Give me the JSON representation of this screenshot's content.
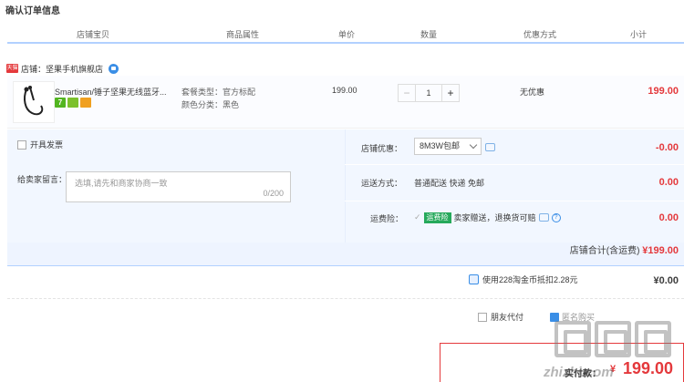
{
  "page": {
    "title": "确认订单信息"
  },
  "columns": [
    "店铺宝贝",
    "商品属性",
    "单价",
    "数量",
    "优惠方式",
    "小计"
  ],
  "shop": {
    "badge": "天猫",
    "label": "店铺：坚果手机旗舰店"
  },
  "item": {
    "name": "Smartisan/锤子坚果无线蓝牙...",
    "tags": [
      {
        "text": "7",
        "color": "#52b520"
      },
      {
        "text": "",
        "color": "#7cc12c"
      },
      {
        "text": "",
        "color": "#f0a020"
      }
    ],
    "prop_package": "套餐类型：官方标配",
    "prop_color": "颜色分类：黑色",
    "price": "199.00",
    "qty_minus": "−",
    "qty": "1",
    "qty_plus": "+",
    "discount": "无优惠",
    "subtotal": "199.00"
  },
  "extras": {
    "invoice_label": "开具发票",
    "message_label": "给卖家留言：",
    "message_placeholder": "选填,请先和商家协商一致",
    "message_count": "0/200",
    "shop_discount_label": "店铺优惠：",
    "shop_discount_option": "8M3W包邮",
    "shop_discount_value": "-0.00",
    "shipping_label": "运送方式：",
    "shipping_text": "普通配送 快递 免邮",
    "shipping_value": "0.00",
    "insurance_label": "运费险：",
    "insurance_tag": "运费险",
    "insurance_text": "卖家赠送，退换货可赔",
    "insurance_value": "0.00",
    "shop_total_label": "店铺合计(含运费)",
    "shop_total_value": "¥199.00"
  },
  "coins": {
    "label": "使用228淘金币抵扣2.28元",
    "value": "¥0.00"
  },
  "options": {
    "friend_pay": "朋友代付",
    "anonymous": "匿名购买"
  },
  "payment": {
    "label": "实付款：",
    "symbol": "¥",
    "amount": "199.00"
  },
  "watermark": {
    "text": "zhizhi.com"
  },
  "colors": {
    "accent_red": "#e4393c",
    "panel_blue": "#eef4ff",
    "border_blue": "#b2d1ff",
    "link_blue": "#3a8ee6"
  }
}
